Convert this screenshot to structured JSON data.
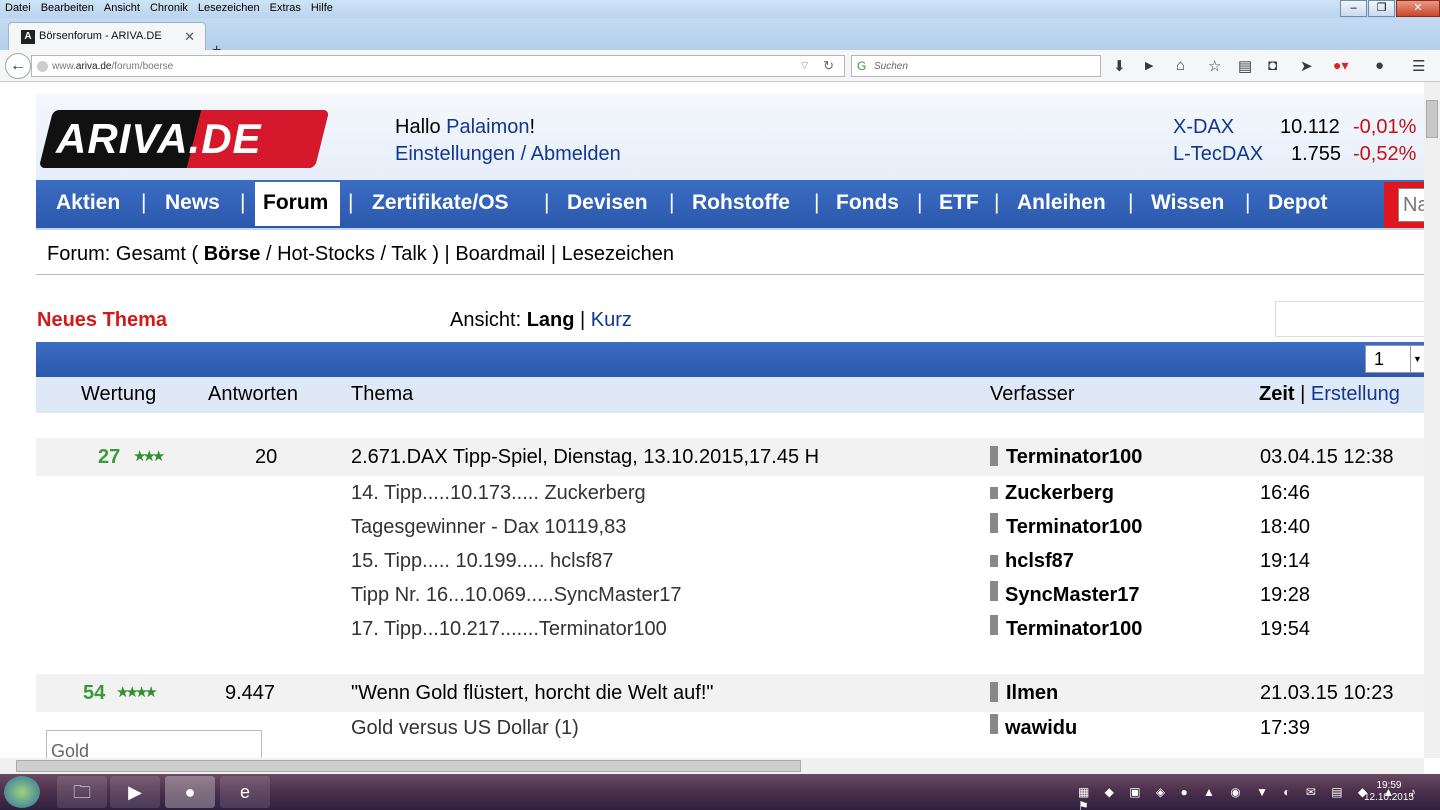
{
  "menubar": [
    "Datei",
    "Bearbeiten",
    "Ansicht",
    "Chronik",
    "Lesezeichen",
    "Extras",
    "Hilfe"
  ],
  "tab": {
    "title": "Börsenforum - ARIVA.DE",
    "favicon": "A"
  },
  "url": {
    "prefix": "www.",
    "host": "ariva.de",
    "path": "/forum/boerse"
  },
  "search": {
    "placeholder": "Suchen"
  },
  "header": {
    "logo": "ARIVA.DE",
    "greeting_hello": "Hallo",
    "username": "Palaimon",
    "greeting_end": "!",
    "settings": "Einstellungen",
    "slash": " / ",
    "logout": "Abmelden",
    "indices": [
      {
        "name": "X-DAX",
        "value": "10.112",
        "change": "-0,01%"
      },
      {
        "name": "L-TecDAX",
        "value": "1.755",
        "change": "-0,52%"
      }
    ]
  },
  "nav": {
    "aktien": "Aktien",
    "news": "News",
    "forum": "Forum",
    "zertifikate": "Zertifikate/OS",
    "devisen": "Devisen",
    "rohstoffe": "Rohstoffe",
    "fonds": "Fonds",
    "etf": "ETF",
    "anleihen": "Anleihen",
    "wissen": "Wissen",
    "depot": "Depot",
    "search_placeholder": "Na",
    "sep": "|"
  },
  "subnav": {
    "prefix": "Forum: Gesamt ( ",
    "boerse": "Börse",
    "s1": " / ",
    "hotstocks": "Hot-Stocks",
    "s2": " / ",
    "talk": "Talk",
    "s3": " ) | ",
    "boardmail": "Boardmail",
    "s4": " | ",
    "lesezeichen": "Lesezeichen"
  },
  "toolbar": {
    "new_topic": "Neues Thema",
    "ansicht_label": "Ansicht: ",
    "lang": "Lang",
    "pipe": " | ",
    "kurz": "Kurz",
    "page": "1"
  },
  "columns": {
    "wertung": "Wertung",
    "antworten": "Antworten",
    "thema": "Thema",
    "verfasser": "Verfasser",
    "zeit": "Zeit",
    "pipe": " | ",
    "erstellung": "Erstellung"
  },
  "threads": [
    {
      "score": "27",
      "stars": "★★★",
      "replies": "20",
      "title": "2.671.DAX Tipp-Spiel, Dienstag, 13.10.2015,17.45 H",
      "author": "Terminator100",
      "time": "03.04.15 12:38",
      "posts": [
        {
          "title": "14. Tipp.....10.173..... Zuckerberg",
          "author": "Zuckerberg",
          "time": "16:46"
        },
        {
          "title": "Tagesgewinner - Dax 10119,83",
          "author": "Terminator100",
          "time": "18:40"
        },
        {
          "title": "15. Tipp..... 10.199..... hclsf87",
          "author": "hclsf87",
          "time": "19:14"
        },
        {
          "title": "Tipp Nr. 16...10.069.....SyncMaster17",
          "author": "SyncMaster17",
          "time": "19:28"
        },
        {
          "title": "17. Tipp...10.217.......Terminator100",
          "author": "Terminator100",
          "time": "19:54"
        }
      ]
    },
    {
      "score": "54",
      "stars": "★★★★",
      "replies": "9.447",
      "title": "\"Wenn Gold flüstert, horcht die Welt auf!\"",
      "author": "Ilmen",
      "time": "21.03.15 10:23",
      "posts": [
        {
          "title": "Gold versus US Dollar (1)",
          "author": "wawidu",
          "time": "17:39"
        }
      ]
    }
  ],
  "sidebox": {
    "placeholder": "Gold"
  },
  "clock": {
    "time": "19:59",
    "date": "12.10.2015"
  },
  "colors": {
    "nav_blue": "#2a58ac",
    "link_blue": "#12378f",
    "accent_red": "#d11a1a",
    "score_green": "#3c9a3c"
  }
}
